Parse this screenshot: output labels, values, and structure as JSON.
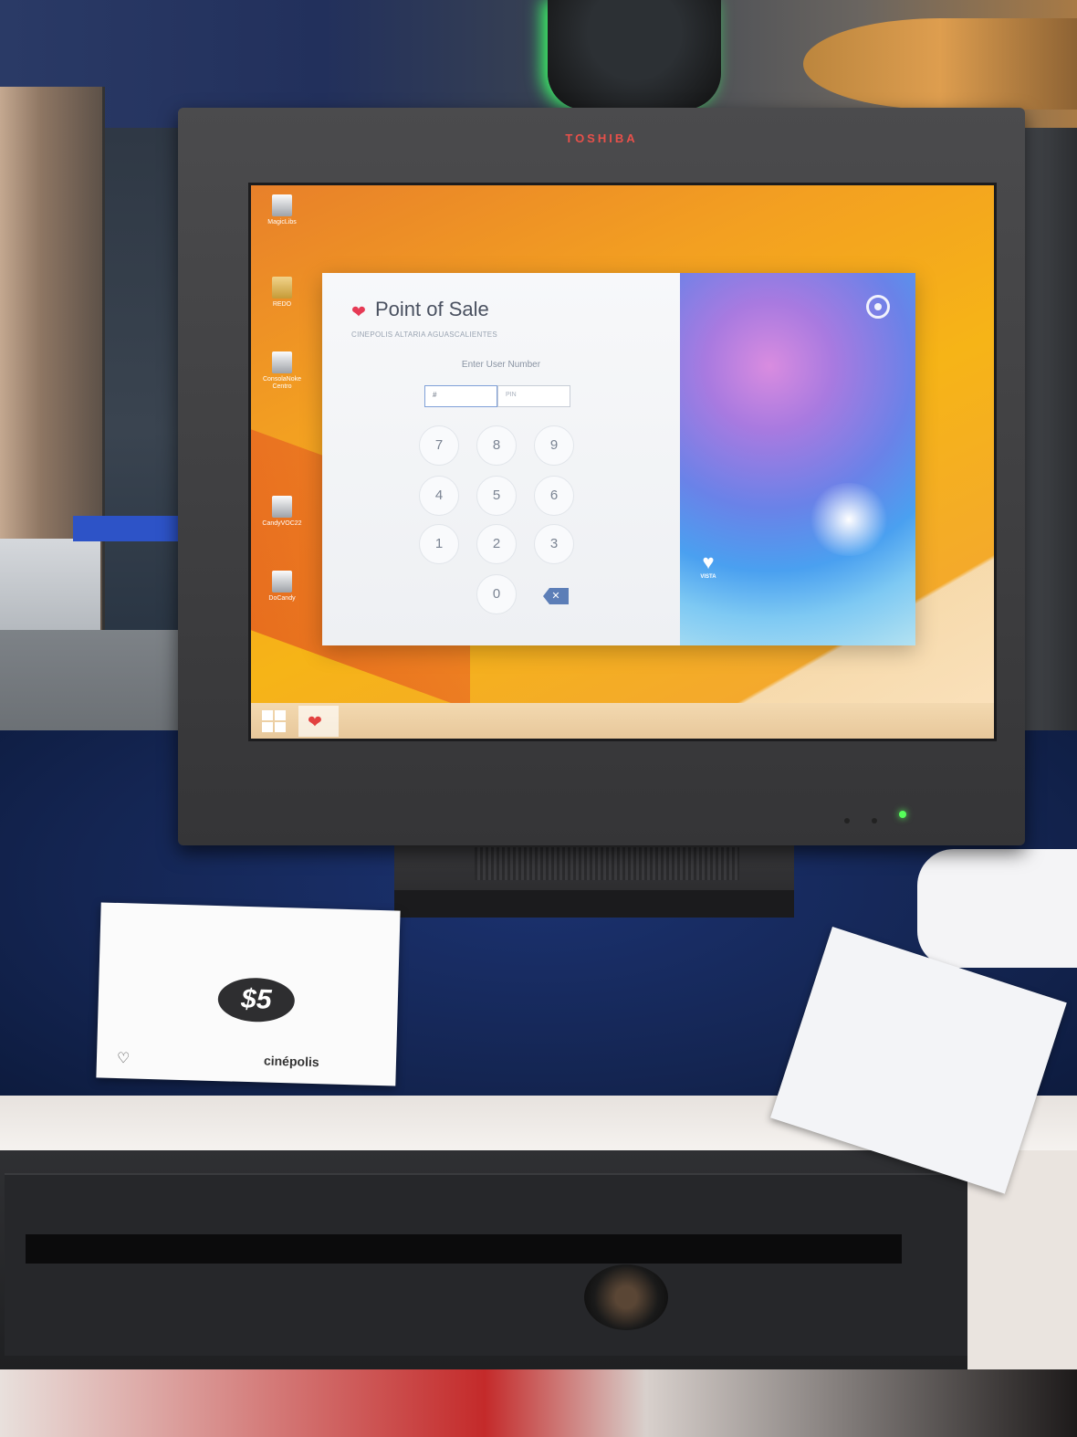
{
  "monitor": {
    "brand": "TOSHIBA"
  },
  "desktop": {
    "icons": [
      {
        "label": "MagicLibs",
        "icon": "app-icon"
      },
      {
        "label": "REDO",
        "icon": "folder-icon"
      },
      {
        "label": "ConsolaNoke Centro",
        "icon": "app-icon"
      },
      {
        "label": "CandyVOC22",
        "icon": "app-icon"
      },
      {
        "label": "DoCandy",
        "icon": "app-icon"
      }
    ],
    "taskbar": {
      "start_icon": "windows-logo-icon",
      "pinned_icon": "point-of-sale-icon"
    }
  },
  "pos": {
    "title": "Point of Sale",
    "site": "CINEPOLIS ALTARIA AGUASCALIENTES",
    "prompt": "Enter User Number",
    "user_field_value": "#",
    "pin_placeholder": "PIN",
    "keypad": [
      "7",
      "8",
      "9",
      "4",
      "5",
      "6",
      "1",
      "2",
      "3",
      "0"
    ],
    "backspace_label": "✕",
    "vendor_word": "VISTA"
  },
  "flyer": {
    "amount": "$5",
    "brand": "cinépolis"
  },
  "colors": {
    "desktop_wallpaper": "#f3a021",
    "pos_accent": "#e63a55",
    "backspace_key": "#5c7eb7",
    "counter": "#142552"
  }
}
